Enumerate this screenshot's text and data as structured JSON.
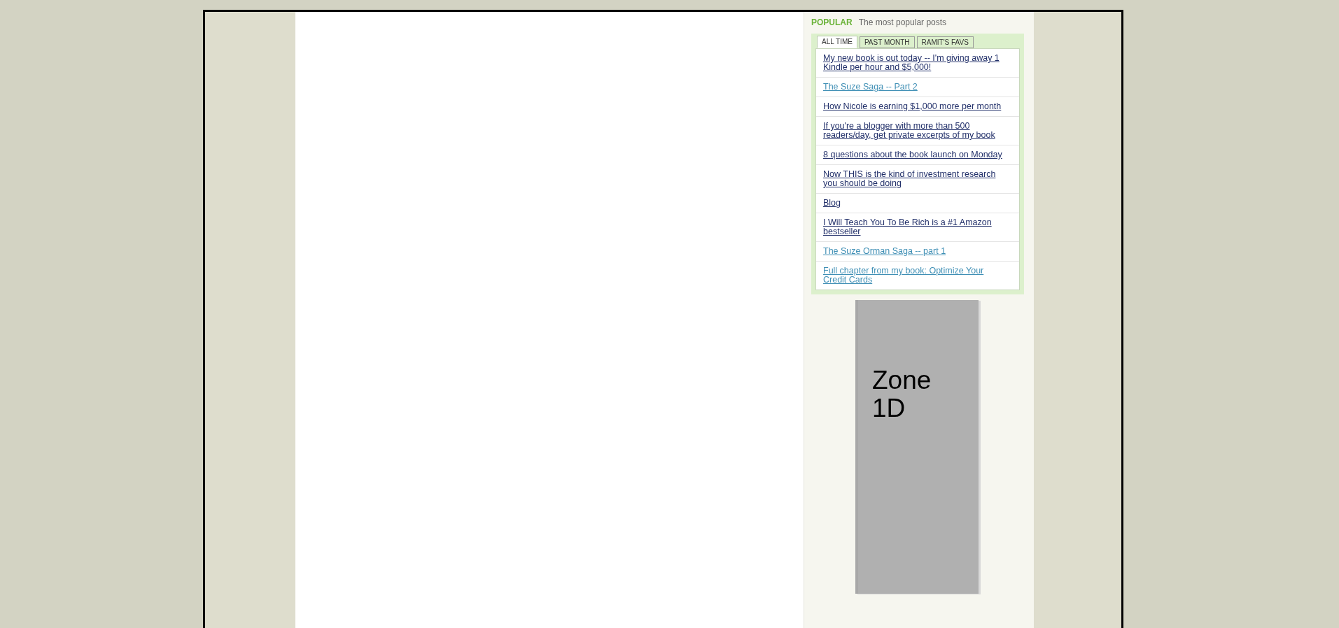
{
  "popular": {
    "heading": "POPULAR",
    "subheading": "The most popular posts"
  },
  "tabs": [
    {
      "label": "ALL TIME",
      "selected": true
    },
    {
      "label": "PAST MONTH",
      "selected": false
    },
    {
      "label": "RAMIT'S FAVS",
      "selected": false
    }
  ],
  "posts": [
    {
      "title": "My new book is out today -- I'm giving away 1 Kindle per hour and $5,000!",
      "visited": false
    },
    {
      "title": "The Suze Saga -- Part 2",
      "visited": true
    },
    {
      "title": "How Nicole is earning $1,000 more per month",
      "visited": false
    },
    {
      "title": "If you're a blogger with more than 500 readers/day, get private excerpts of my book",
      "visited": false
    },
    {
      "title": "8 questions about the book launch on Monday",
      "visited": false
    },
    {
      "title": "Now THIS is the kind of investment research you should be doing",
      "visited": false
    },
    {
      "title": "Blog",
      "visited": false
    },
    {
      "title": "I Will Teach You To Be Rich is a #1 Amazon bestseller",
      "visited": false
    },
    {
      "title": "The Suze Orman Saga -- part 1",
      "visited": true
    },
    {
      "title": "Full chapter from my book: Optimize Your Credit Cards",
      "visited": true
    }
  ],
  "ad_zone": {
    "label": "Zone 1D"
  }
}
